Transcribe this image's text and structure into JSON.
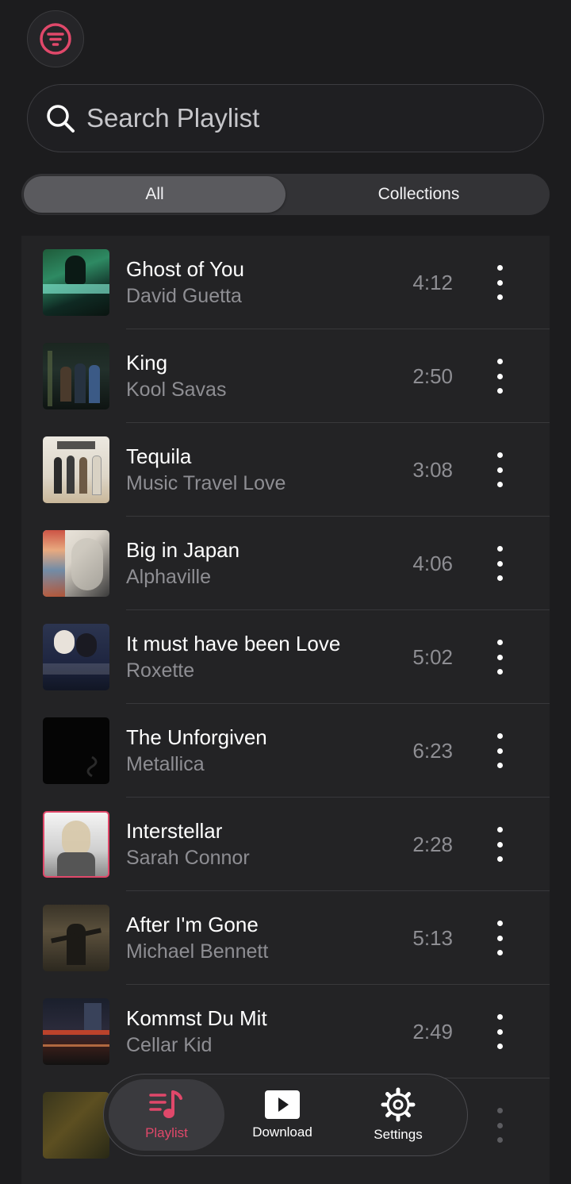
{
  "accent_color": "#e0486a",
  "header": {
    "filter_icon": "filter-icon"
  },
  "search": {
    "placeholder": "Search Playlist",
    "value": ""
  },
  "segments": {
    "all_label": "All",
    "collections_label": "Collections",
    "selected": "All"
  },
  "tracks": [
    {
      "title": "Ghost of You",
      "artist": "David Guetta",
      "duration": "4:12"
    },
    {
      "title": "King",
      "artist": "Kool Savas",
      "duration": "2:50"
    },
    {
      "title": "Tequila",
      "artist": "Music Travel Love",
      "duration": "3:08"
    },
    {
      "title": "Big in Japan",
      "artist": "Alphaville",
      "duration": "4:06"
    },
    {
      "title": "It must have been Love",
      "artist": "Roxette",
      "duration": "5:02"
    },
    {
      "title": "The Unforgiven",
      "artist": "Metallica",
      "duration": "6:23"
    },
    {
      "title": "Interstellar",
      "artist": "Sarah Connor",
      "duration": "2:28"
    },
    {
      "title": "After I'm Gone",
      "artist": "Michael Bennett",
      "duration": "5:13"
    },
    {
      "title": "Kommst Du Mit",
      "artist": "Cellar Kid",
      "duration": "2:49"
    }
  ],
  "tabbar": {
    "playlist_label": "Playlist",
    "download_label": "Download",
    "settings_label": "Settings",
    "active": "Playlist"
  }
}
